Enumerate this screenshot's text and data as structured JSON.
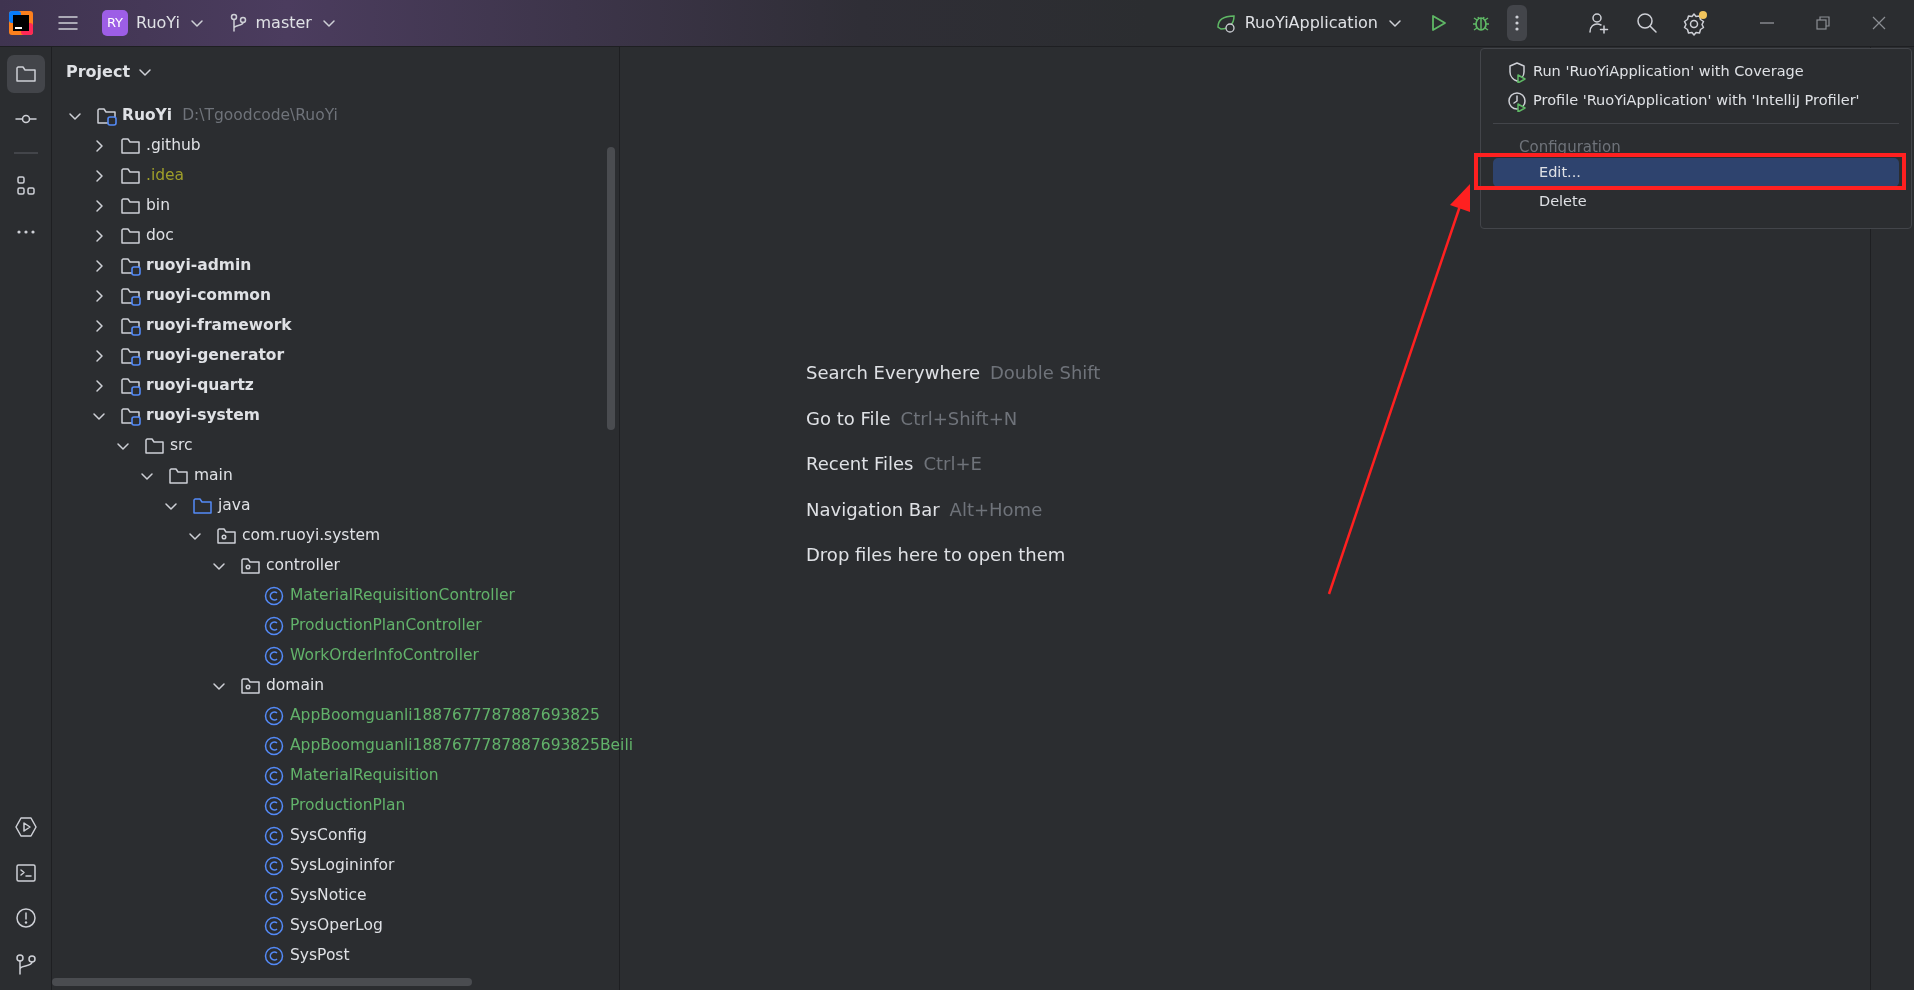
{
  "title_bar": {
    "project_badge": "RY",
    "project": "RuoYi",
    "branch": "master",
    "run_config": "RuoYiApplication",
    "more_selected": true,
    "settings_notification": true
  },
  "tool_stripe": [
    {
      "kind": "project",
      "selected": true
    },
    {
      "kind": "commit",
      "selected": false
    },
    {
      "kind": "structure",
      "selected": false
    },
    {
      "kind": "more",
      "selected": false
    },
    {
      "kind": "services",
      "selected": false
    },
    {
      "kind": "terminal",
      "selected": false
    },
    {
      "kind": "problems",
      "selected": false
    },
    {
      "kind": "git",
      "selected": false
    }
  ],
  "project_panel": {
    "title": "Project",
    "tree": [
      {
        "label": "RuoYi",
        "path": "D:\\Tgoodcode\\RuoYi",
        "kind": "module",
        "expanded": true,
        "children": [
          {
            "label": ".github",
            "kind": "folder",
            "expanded": false
          },
          {
            "label": ".idea",
            "kind": "folder",
            "expanded": false,
            "color": "#9e9e2a"
          },
          {
            "label": "bin",
            "kind": "folder",
            "expanded": false
          },
          {
            "label": "doc",
            "kind": "folder",
            "expanded": false
          },
          {
            "label": "ruoyi-admin",
            "kind": "module",
            "expanded": false
          },
          {
            "label": "ruoyi-common",
            "kind": "module",
            "expanded": false
          },
          {
            "label": "ruoyi-framework",
            "kind": "module",
            "expanded": false
          },
          {
            "label": "ruoyi-generator",
            "kind": "module",
            "expanded": false
          },
          {
            "label": "ruoyi-quartz",
            "kind": "module",
            "expanded": false
          },
          {
            "label": "ruoyi-system",
            "kind": "module",
            "expanded": true,
            "children": [
              {
                "label": "src",
                "kind": "folder",
                "expanded": true,
                "children": [
                  {
                    "label": "main",
                    "kind": "folder",
                    "expanded": true,
                    "children": [
                      {
                        "label": "java",
                        "kind": "source",
                        "expanded": true,
                        "children": [
                          {
                            "label": "com.ruoyi.system",
                            "kind": "package",
                            "expanded": true,
                            "children": [
                              {
                                "label": "controller",
                                "kind": "package",
                                "expanded": true,
                                "children": [
                                  {
                                    "label": "MaterialRequisitionController",
                                    "kind": "class",
                                    "color": "#62b26a"
                                  },
                                  {
                                    "label": "ProductionPlanController",
                                    "kind": "class",
                                    "color": "#62b26a"
                                  },
                                  {
                                    "label": "WorkOrderInfoController",
                                    "kind": "class",
                                    "color": "#62b26a"
                                  }
                                ]
                              },
                              {
                                "label": "domain",
                                "kind": "package",
                                "expanded": true,
                                "children": [
                                  {
                                    "label": "AppBoomguanli1887677787887693825",
                                    "kind": "class",
                                    "color": "#62b26a"
                                  },
                                  {
                                    "label": "AppBoomguanli1887677787887693825Beili",
                                    "kind": "class",
                                    "color": "#62b26a"
                                  },
                                  {
                                    "label": "MaterialRequisition",
                                    "kind": "class",
                                    "color": "#62b26a"
                                  },
                                  {
                                    "label": "ProductionPlan",
                                    "kind": "class",
                                    "color": "#62b26a"
                                  },
                                  {
                                    "label": "SysConfig",
                                    "kind": "class"
                                  },
                                  {
                                    "label": "SysLogininfor",
                                    "kind": "class"
                                  },
                                  {
                                    "label": "SysNotice",
                                    "kind": "class"
                                  },
                                  {
                                    "label": "SysOperLog",
                                    "kind": "class"
                                  },
                                  {
                                    "label": "SysPost",
                                    "kind": "class"
                                  }
                                ]
                              }
                            ]
                          }
                        ]
                      }
                    ]
                  }
                ]
              }
            ]
          }
        ]
      }
    ]
  },
  "editor_hints": [
    {
      "action": "Search Everywhere",
      "shortcut": "Double Shift"
    },
    {
      "action": "Go to File",
      "shortcut": "Ctrl+Shift+N"
    },
    {
      "action": "Recent Files",
      "shortcut": "Ctrl+E"
    },
    {
      "action": "Navigation Bar",
      "shortcut": "Alt+Home"
    },
    {
      "action": "Drop files here to open them"
    }
  ],
  "popup_menu": {
    "items": [
      {
        "kind": "coverage",
        "label": "Run 'RuoYiApplication' with Coverage",
        "selected": false
      },
      {
        "kind": "profile",
        "label": "Profile 'RuoYiApplication' with 'IntelliJ Profiler'",
        "selected": false
      },
      {
        "kind": "separator"
      },
      {
        "kind": "header",
        "label": "Configuration"
      },
      {
        "kind": "item",
        "label": "Edit...",
        "selected": true
      },
      {
        "kind": "item",
        "label": "Delete",
        "selected": false
      }
    ]
  },
  "annotations": {
    "highlight_box": true,
    "arrow": true
  }
}
